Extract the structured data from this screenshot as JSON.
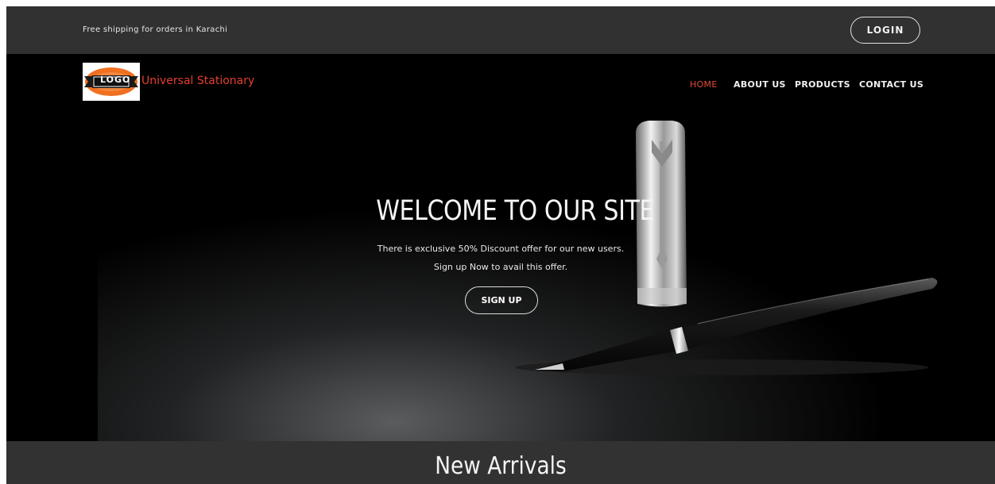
{
  "topbar": {
    "shipping_text": "Free shipping for orders in Karachi",
    "login_label": "LOGIN"
  },
  "header": {
    "logo_text": "LOGO",
    "brand_name": "Universal Stationary",
    "nav": [
      {
        "label": "HOME",
        "active": true
      },
      {
        "label": "ABOUT US",
        "active": false
      },
      {
        "label": "PRODUCTS",
        "active": false
      },
      {
        "label": "CONTACT US",
        "active": false
      }
    ]
  },
  "hero": {
    "title": "WELCOME TO OUR SITE",
    "line1": "There is exclusive 50% Discount offer for our new users.",
    "line2": "Sign up Now to avail this offer.",
    "cta_label": "SIGN UP"
  },
  "section": {
    "title": "New Arrivals"
  },
  "colors": {
    "accent": "#e04a37",
    "topbar_bg": "#313131",
    "hero_bg": "#000000",
    "section_bg": "#323232"
  }
}
